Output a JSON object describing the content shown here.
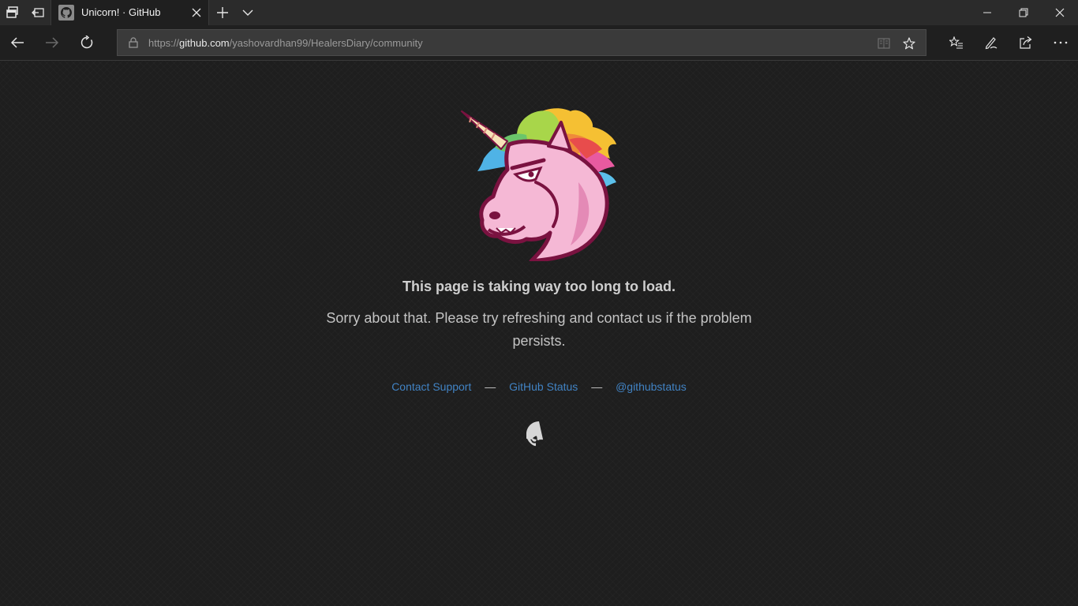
{
  "browser": {
    "tab": {
      "title": "Unicorn! · GitHub"
    },
    "address": {
      "prefix": "https://",
      "host": "github.com",
      "path": "/yashovardhan99/HealersDiary/community"
    },
    "icons": {
      "tab_actions": "tab-actions-icon",
      "set_aside": "set-aside-tabs-icon",
      "new_tab": "plus-icon",
      "tab_preview": "chevron-down-icon",
      "minimize": "minimize-icon",
      "restore": "restore-icon",
      "close": "close-icon",
      "back": "back-arrow-icon",
      "forward": "forward-arrow-icon",
      "refresh": "refresh-icon",
      "lock": "lock-icon",
      "reading_view": "reading-view-icon",
      "favorite": "star-icon",
      "favorites_hub": "favorites-hub-icon",
      "notes": "pen-icon",
      "share": "share-icon",
      "more": "ellipsis-icon"
    }
  },
  "page": {
    "headline": "This page is taking way too long to load.",
    "message": "Sorry about that. Please try refreshing and contact us if the problem persists.",
    "links": [
      {
        "label": "Contact Support"
      },
      {
        "label": "GitHub Status"
      },
      {
        "label": "@githubstatus"
      }
    ],
    "separator": "—",
    "colors": {
      "link": "#4183c4",
      "background": "#1e1e1e",
      "text": "#c4c4c4"
    }
  }
}
